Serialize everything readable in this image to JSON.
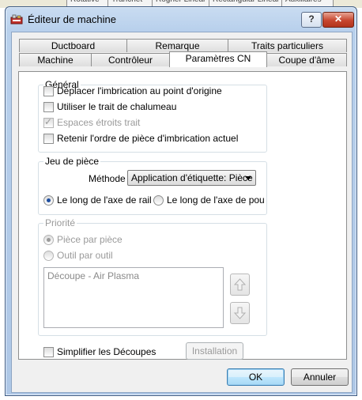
{
  "background": {
    "tabs": [
      "Rotative",
      "Tranchet",
      "Rogner Linear",
      "Rectangular Linear",
      "Auxiliaires"
    ]
  },
  "window": {
    "title": "Éditeur de machine",
    "help_label": "?",
    "close_label": "✕"
  },
  "tabs": {
    "row1": [
      "Ductboard",
      "Remarque",
      "Traits particuliers"
    ],
    "row2": [
      "Machine",
      "Contrôleur",
      "Paramètres CN",
      "Coupe d'âme"
    ],
    "active": "Paramètres CN"
  },
  "general": {
    "title": "Général",
    "options": [
      {
        "label": "Déplacer l'imbrication au point d'origine",
        "checked": false,
        "enabled": true
      },
      {
        "label": "Utiliser le trait de chalumeau",
        "checked": false,
        "enabled": true
      },
      {
        "label": "Espaces étroits trait",
        "checked": true,
        "enabled": false
      },
      {
        "label": "Retenir l'ordre de pièce d'imbrication actuel",
        "checked": false,
        "enabled": true
      }
    ]
  },
  "jeu": {
    "title": "Jeu de pièce",
    "method_label": "Méthode",
    "method_value": "Application d'étiquette: Pièce",
    "radio1": "Le long de l'axe de rail",
    "radio2": "Le long de l'axe de pou"
  },
  "priorite": {
    "title": "Priorité",
    "radio1": "Pièce par pièce",
    "radio2": "Outil par outil",
    "list_items": [
      "Découpe - Air Plasma"
    ]
  },
  "simplify_label": "Simplifier les Découpes",
  "install_label": "Installation",
  "ok_label": "OK",
  "cancel_label": "Annuler"
}
